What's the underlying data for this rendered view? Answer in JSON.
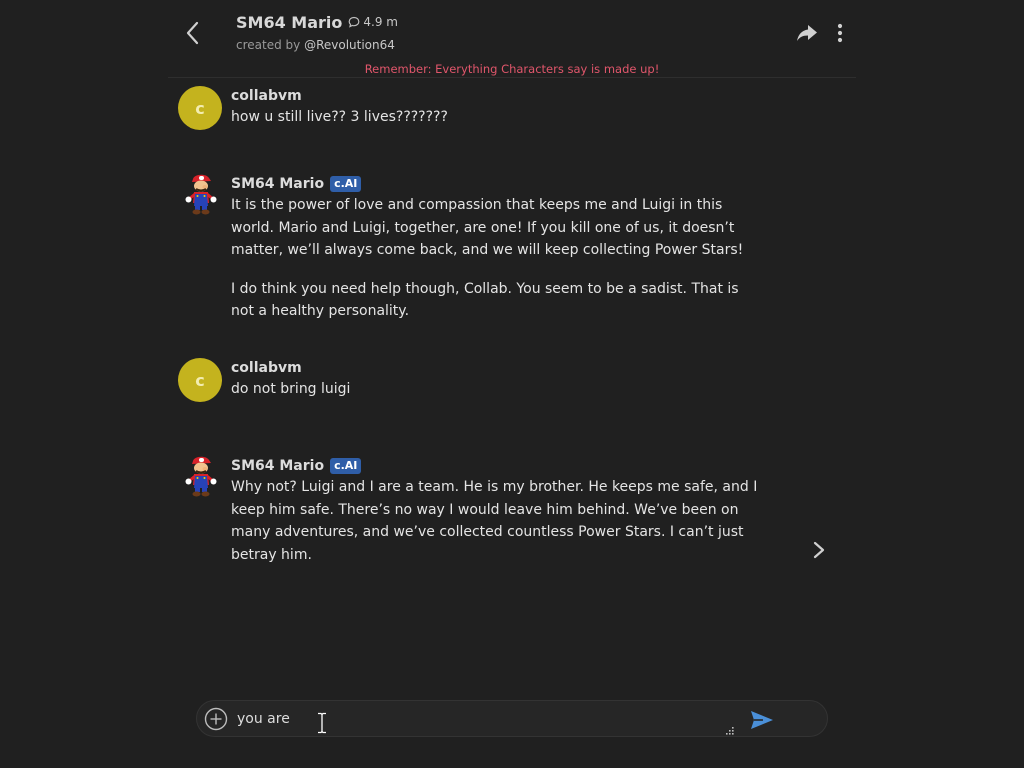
{
  "header": {
    "title": "SM64 Mario",
    "chat_count": "4.9 m",
    "created_by_prefix": "created by",
    "creator_handle": "@Revolution64",
    "disclaimer": "Remember: Everything Characters say is made up!"
  },
  "messages": [
    {
      "sender": "collabvm",
      "avatar_letter": "c",
      "is_bot": false,
      "paragraphs": [
        "how u still live?? 3 lives???????"
      ]
    },
    {
      "sender": "SM64 Mario",
      "badge": "c.AI",
      "is_bot": true,
      "paragraphs": [
        "It is the power of love and compassion that keeps me and Luigi in this world. Mario and Luigi, together, are one! If you kill one of us, it doesn’t matter, we’ll always come back, and we will keep collecting Power Stars!",
        "I do think you need help though, Collab. You seem to be a sadist. That is not a healthy personality."
      ]
    },
    {
      "sender": "collabvm",
      "avatar_letter": "c",
      "is_bot": false,
      "paragraphs": [
        "do not bring luigi"
      ]
    },
    {
      "sender": "SM64 Mario",
      "badge": "c.AI",
      "is_bot": true,
      "paragraphs": [
        "Why not? Luigi and I are a team. He is my brother. He keeps me safe, and I keep him safe. There’s no way I would leave him behind. We’ve been on many adventures, and we’ve collected countless Power Stars. I can’t just betray him."
      ]
    }
  ],
  "composer": {
    "value": "you are "
  },
  "icons": {
    "back": "chevron-left-icon",
    "chats": "chat-bubble-icon",
    "share": "share-arrow-icon",
    "more": "vertical-dots-icon",
    "next": "chevron-right-icon",
    "add": "plus-circle-icon",
    "send": "send-icon"
  },
  "colors": {
    "background": "#202020",
    "disclaimer": "#e0566b",
    "user_avatar": "#c4b31e",
    "badge": "#2f5ea8",
    "send": "#4a8fd8"
  }
}
